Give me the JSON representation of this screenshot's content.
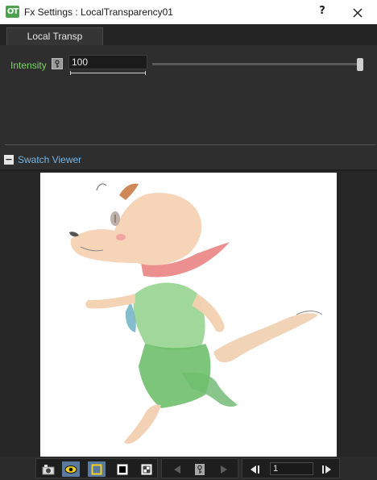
{
  "window": {
    "app_logo": "OT",
    "title": "Fx Settings : LocalTransparency01",
    "help_label": "?"
  },
  "tabs": [
    {
      "label": "Local Transp",
      "active": true
    }
  ],
  "params": {
    "intensity": {
      "label": "Intensity",
      "value": "100",
      "slider_fraction": 1.0
    }
  },
  "swatch": {
    "collapse_label": "−",
    "title": "Swatch Viewer"
  },
  "toolbar": {
    "frame_value": "1",
    "icons": [
      "camera-icon",
      "eye-icon",
      "yellow-frame-icon",
      "black-bg-icon",
      "checker-bg-icon",
      "prev-arrow-icon",
      "key-icon",
      "next-arrow-icon",
      "first-frame-icon",
      "last-frame-icon"
    ]
  },
  "colors": {
    "accent_green": "#7fd46a",
    "accent_blue": "#74b6e8",
    "toggle_on": "#5a7aa0"
  }
}
